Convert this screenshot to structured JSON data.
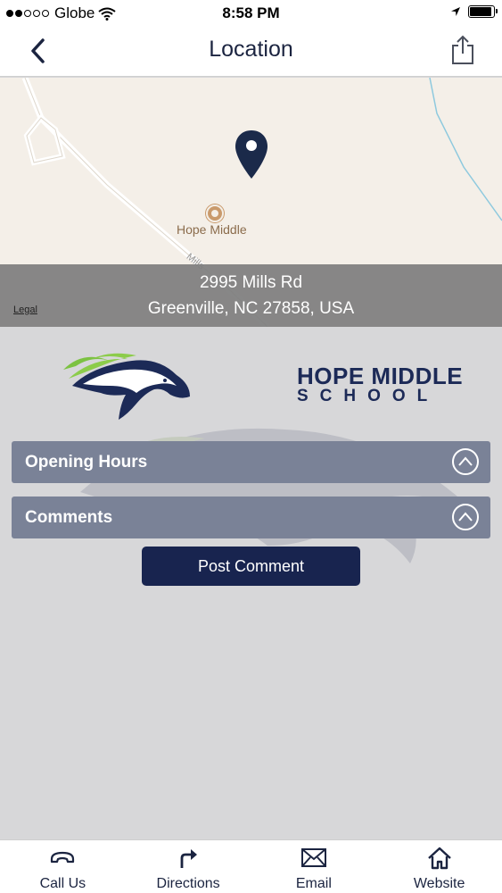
{
  "status_bar": {
    "carrier": "Globe",
    "time": "8:58 PM"
  },
  "nav": {
    "title": "Location",
    "back_icon": "chevron-left-icon",
    "share_icon": "share-icon"
  },
  "map": {
    "poi_name": "Hope Middle",
    "road_label": "Mills",
    "address_line1": "2995 Mills Rd",
    "address_line2": "Greenville, NC 27858, USA",
    "legal": "Legal",
    "pin_color": "#1b2a4a"
  },
  "logo": {
    "line1": "HOPE MIDDLE",
    "line2": "SCHOOL"
  },
  "sections": [
    {
      "label": "Opening Hours",
      "icon": "chevron-up-icon"
    },
    {
      "label": "Comments",
      "icon": "chevron-up-icon"
    }
  ],
  "post_comment": {
    "label": "Post Comment"
  },
  "tabs": [
    {
      "label": "Call Us",
      "icon": "phone-icon"
    },
    {
      "label": "Directions",
      "icon": "directions-icon"
    },
    {
      "label": "Email",
      "icon": "email-icon"
    },
    {
      "label": "Website",
      "icon": "home-icon"
    }
  ],
  "colors": {
    "accent": "#18244f",
    "section_bg": "#7a8297",
    "background": "#d7d7d9"
  }
}
